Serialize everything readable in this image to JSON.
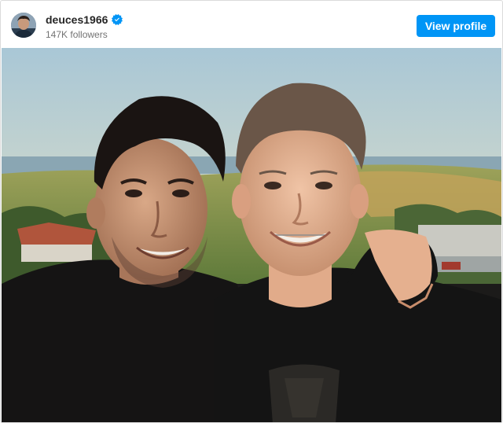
{
  "post": {
    "username": "deuces1966",
    "verified": true,
    "followers": "147K followers",
    "view_profile_label": "View profile",
    "accent_color": "#0095f6",
    "verified_color": "#0095f6"
  },
  "icons": {
    "avatar": "avatar-photo",
    "verified": "verified-badge-icon"
  }
}
